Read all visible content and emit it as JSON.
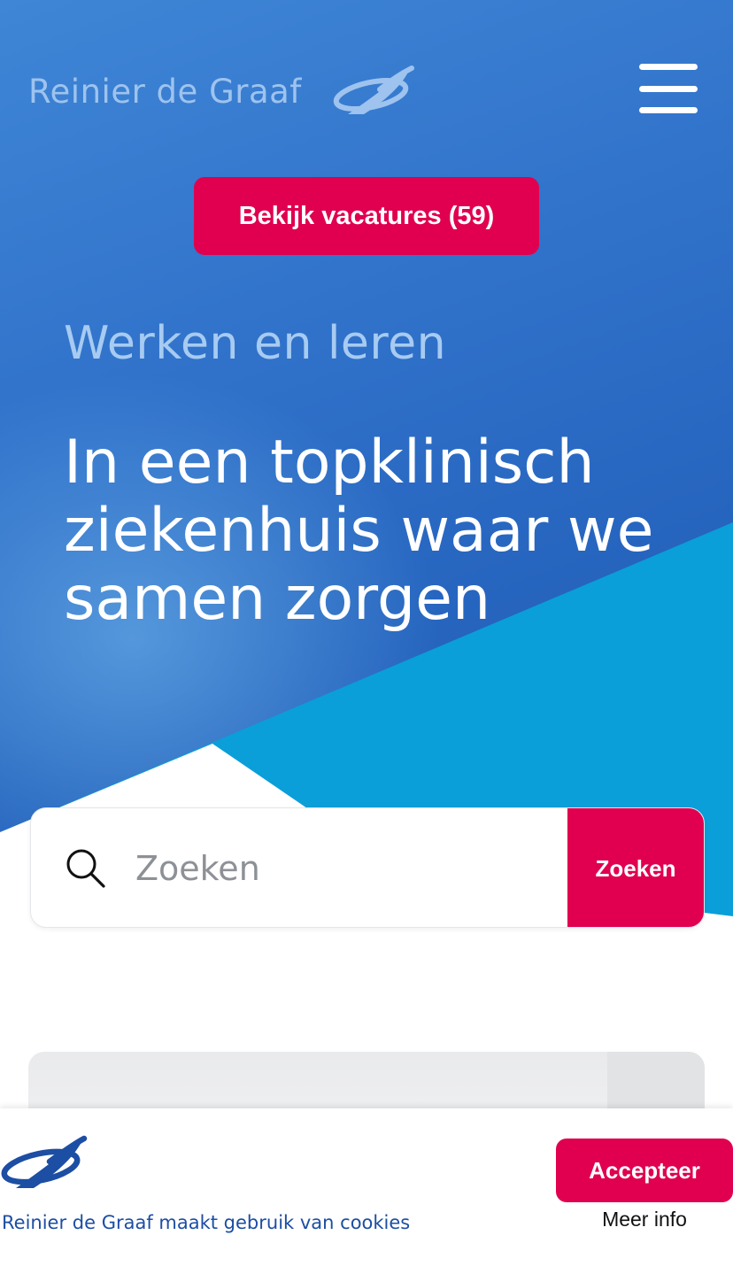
{
  "header": {
    "logo_text": "Reinier de Graaf",
    "logo_icon": "rdg-swirl-logo",
    "menu_icon": "hamburger-menu-icon"
  },
  "hero": {
    "cta_label": "Bekijk vacatures (59)",
    "kicker": "Werken en leren",
    "headline": "In een topklinisch ziekenhuis waar we samen zorgen"
  },
  "search": {
    "placeholder": "Zoeken",
    "value": "",
    "submit_label": "Zoeken",
    "icon": "search-icon"
  },
  "cookie_bar": {
    "message": "Reinier de Graaf maakt gebruik van cookies",
    "accept_label": "Accepteer",
    "more_info_label": "Meer info"
  },
  "colors": {
    "hero_blue": "#2f70c9",
    "hero_light_blue": "#0a9fd9",
    "accent_pink": "#e0004f",
    "brand_blue": "#1c4ea3"
  }
}
